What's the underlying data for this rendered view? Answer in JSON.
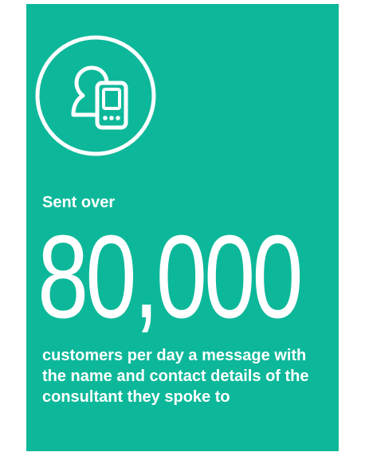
{
  "colors": {
    "card_background": "#0db89a",
    "foreground": "#ffffff"
  },
  "icon": {
    "name": "person-with-mobile-phone-icon"
  },
  "stat": {
    "lead_text": "Sent over",
    "value": "80,000",
    "description": "customers per day a message with the name and contact details of the consultant they spoke to"
  }
}
